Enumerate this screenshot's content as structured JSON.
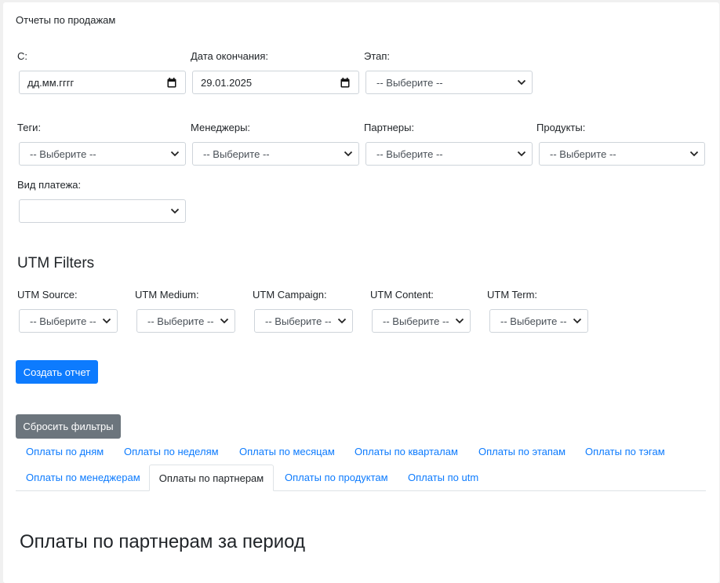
{
  "page": {
    "title": "Отчеты по продажам"
  },
  "filters": {
    "from_label": "С:",
    "from_placeholder": "дд.мм.гггг",
    "end_label": "Дата окончания:",
    "end_value": "29.01.2025",
    "stage_label": "Этап:",
    "stage_value": "-- Выберите --",
    "tags_label": "Теги:",
    "tags_value": "-- Выберите --",
    "managers_label": "Менеджеры:",
    "managers_value": "-- Выберите --",
    "partners_label": "Партнеры:",
    "partners_value": "-- Выберите --",
    "products_label": "Продукты:",
    "products_value": "-- Выберите --",
    "payment_label": "Вид платежа:",
    "payment_value": ""
  },
  "utm": {
    "title": "UTM Filters",
    "source_label": "UTM Source:",
    "source_value": "-- Выберите --",
    "medium_label": "UTM Medium:",
    "medium_value": "-- Выберите --",
    "campaign_label": "UTM Campaign:",
    "campaign_value": "-- Выберите --",
    "content_label": "UTM Content:",
    "content_value": "-- Выберите --",
    "term_label": "UTM Term:",
    "term_value": "-- Выберите --"
  },
  "actions": {
    "create_label": "Создать отчет",
    "reset_label": "Сбросить фильтры"
  },
  "tabs": [
    {
      "label": "Оплаты по дням"
    },
    {
      "label": "Оплаты по неделям"
    },
    {
      "label": "Оплаты по месяцам"
    },
    {
      "label": "Оплаты по кварталам"
    },
    {
      "label": "Оплаты по этапам"
    },
    {
      "label": "Оплаты по тэгам"
    },
    {
      "label": "Оплаты по менеджерам"
    },
    {
      "label": "Оплаты по партнерам",
      "active": true
    },
    {
      "label": "Оплаты по продуктам"
    },
    {
      "label": "Оплаты по utm"
    }
  ],
  "section": {
    "heading": "Оплаты по партнерам за период"
  },
  "colors": {
    "primary": "#0d7bfe",
    "secondary": "#6c757d",
    "border": "#ced4da"
  },
  "icons": {
    "date_picker": "calendar-icon",
    "select": "chevron-down-icon"
  }
}
